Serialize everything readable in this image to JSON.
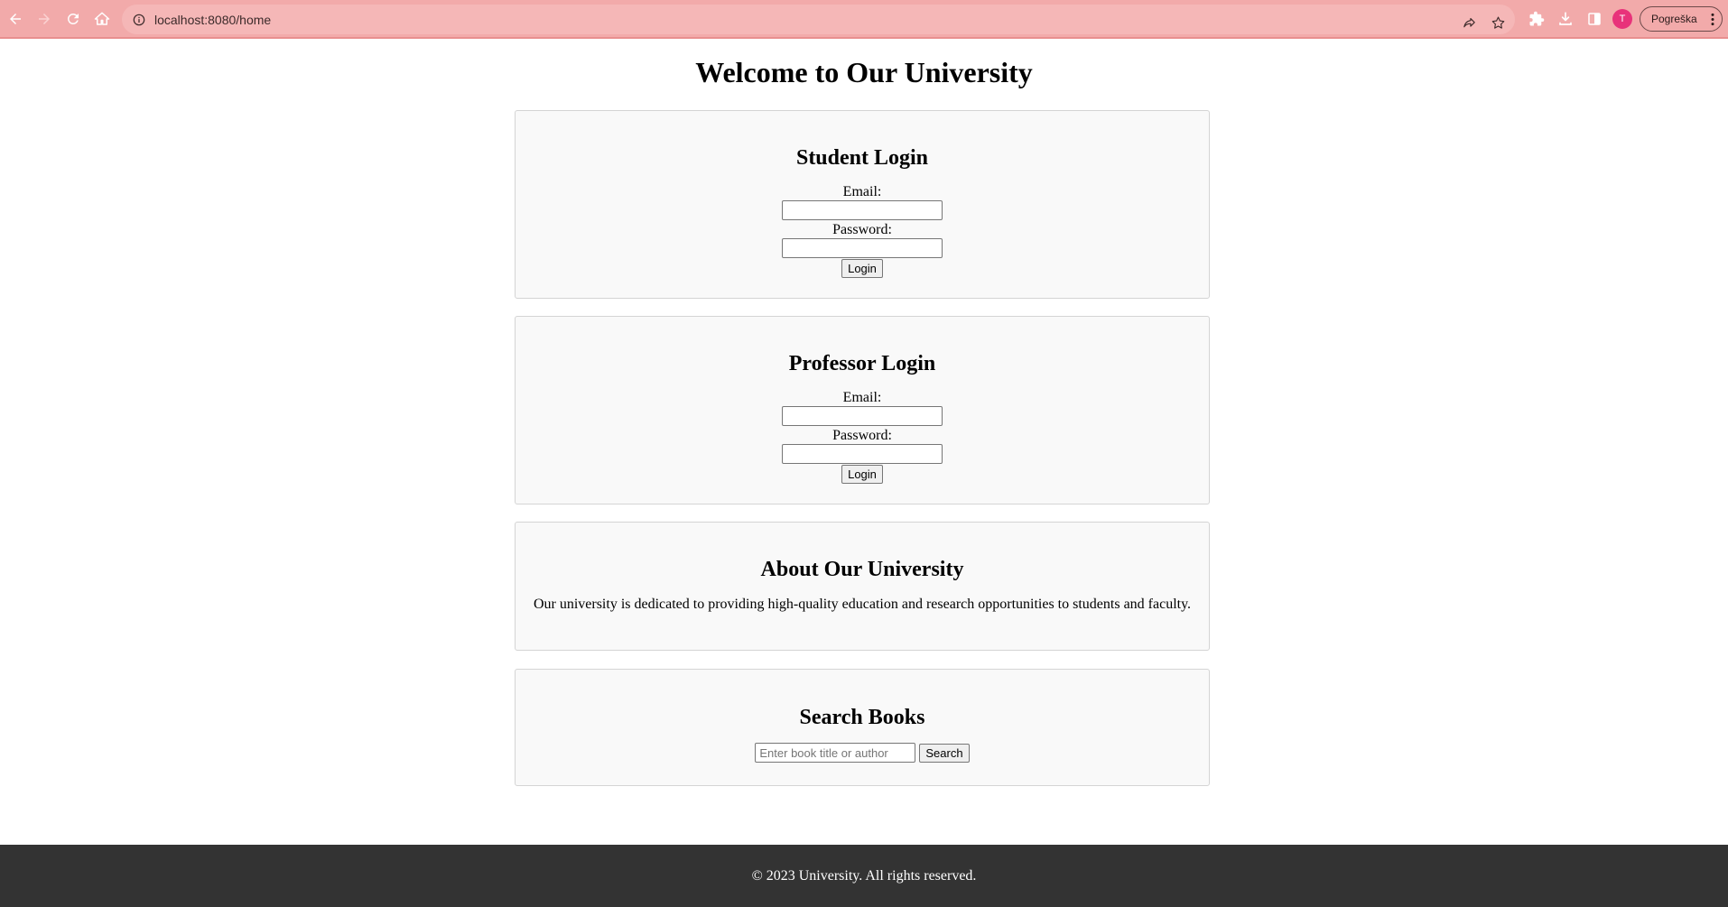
{
  "browser": {
    "url": "localhost:8080/home",
    "avatar_initial": "T",
    "profile_label": "Pogreška"
  },
  "colors": {
    "chrome_bg": "#f2aaaa",
    "card_bg": "#f9f9f9",
    "footer_bg": "#333333",
    "avatar_bg": "#e8327a"
  },
  "page": {
    "title": "Welcome to Our University"
  },
  "student_login": {
    "heading": "Student Login",
    "email_label": "Email:",
    "password_label": "Password:",
    "email_value": "",
    "password_value": "",
    "button_label": "Login"
  },
  "professor_login": {
    "heading": "Professor Login",
    "email_label": "Email:",
    "password_label": "Password:",
    "email_value": "",
    "password_value": "",
    "button_label": "Login"
  },
  "about": {
    "heading": "About Our University",
    "text": "Our university is dedicated to providing high-quality education and research opportunities to students and faculty."
  },
  "search": {
    "heading": "Search Books",
    "placeholder": "Enter book title or author",
    "value": "",
    "button_label": "Search"
  },
  "footer": {
    "text": "© 2023 University. All rights reserved."
  }
}
